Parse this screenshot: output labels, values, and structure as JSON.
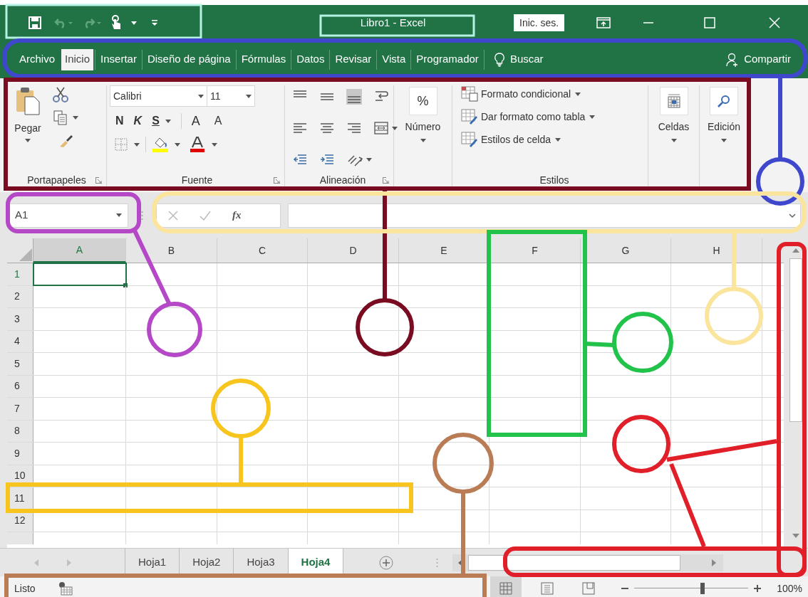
{
  "window": {
    "title": "Libro1 - Excel",
    "sign_in": "Inic. ses."
  },
  "tabs": [
    {
      "label": "Archivo",
      "selected": false
    },
    {
      "label": "Inicio",
      "selected": true
    },
    {
      "label": "Insertar",
      "selected": false
    },
    {
      "label": "Diseño de página",
      "selected": false
    },
    {
      "label": "Fórmulas",
      "selected": false
    },
    {
      "label": "Datos",
      "selected": false
    },
    {
      "label": "Revisar",
      "selected": false
    },
    {
      "label": "Vista",
      "selected": false
    },
    {
      "label": "Programador",
      "selected": false
    }
  ],
  "search": {
    "label": "Buscar"
  },
  "share": {
    "label": "Compartir"
  },
  "ribbon": {
    "clipboard": {
      "paste": "Pegar",
      "label": "Portapapeles"
    },
    "font": {
      "name": "Calibri",
      "size": "11",
      "bold": "N",
      "italic": "K",
      "underline": "S",
      "grow": "A",
      "shrink": "A",
      "label": "Fuente"
    },
    "alignment": {
      "label": "Alineación"
    },
    "number": {
      "symbol": "%",
      "label": "Número"
    },
    "styles": {
      "items": [
        "Formato condicional",
        "Dar formato como tabla",
        "Estilos de celda"
      ],
      "label": "Estilos"
    },
    "cells": {
      "label": "Celdas"
    },
    "editing": {
      "label": "Edición"
    }
  },
  "formula_bar": {
    "name_box": "A1",
    "function_label": "fx"
  },
  "columns": [
    {
      "label": "A",
      "selected": true
    },
    {
      "label": "B",
      "selected": false
    },
    {
      "label": "C",
      "selected": false
    },
    {
      "label": "D",
      "selected": false
    },
    {
      "label": "E",
      "selected": false
    },
    {
      "label": "F",
      "selected": false
    },
    {
      "label": "G",
      "selected": false
    },
    {
      "label": "H",
      "selected": false
    }
  ],
  "rows": [
    {
      "label": "1",
      "selected": true
    },
    {
      "label": "2",
      "selected": false
    },
    {
      "label": "3",
      "selected": false
    },
    {
      "label": "4",
      "selected": false
    },
    {
      "label": "5",
      "selected": false
    },
    {
      "label": "6",
      "selected": false
    },
    {
      "label": "7",
      "selected": false
    },
    {
      "label": "8",
      "selected": false
    },
    {
      "label": "9",
      "selected": false
    },
    {
      "label": "10",
      "selected": false
    },
    {
      "label": "11",
      "selected": false
    },
    {
      "label": "12",
      "selected": false
    }
  ],
  "sheets": [
    {
      "label": "Hoja1",
      "selected": false
    },
    {
      "label": "Hoja2",
      "selected": false
    },
    {
      "label": "Hoja3",
      "selected": false
    },
    {
      "label": "Hoja4",
      "selected": true
    }
  ],
  "status_bar": {
    "status": "Listo",
    "views": [
      {
        "kind": "normal",
        "selected": true
      },
      {
        "kind": "page_layout",
        "selected": false
      },
      {
        "kind": "page_break",
        "selected": false
      }
    ],
    "zoom": {
      "level": 0.6,
      "reading": "100%"
    }
  },
  "annotations": [
    {
      "color": "#b6f2e2"
    },
    {
      "color": "#b6f2e2"
    },
    {
      "color": "#3f48cc"
    },
    {
      "color": "#7a0c22"
    },
    {
      "color": "#b548c6"
    },
    {
      "color": "#fbe49c"
    },
    {
      "color": "#22c34b"
    },
    {
      "color": "#f7c51e"
    },
    {
      "color": "#b97c55"
    },
    {
      "color": "#e01f28"
    }
  ]
}
